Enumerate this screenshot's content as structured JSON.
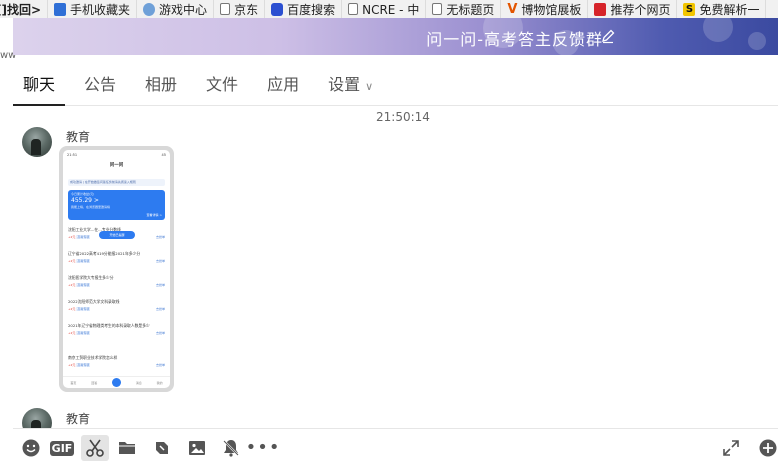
{
  "bookmarks": [
    {
      "label": "[]找回>",
      "icon": "none"
    },
    {
      "label": "手机收藏夹",
      "icon": "mobile-icon"
    },
    {
      "label": "游戏中心",
      "icon": "game-icon"
    },
    {
      "label": "京东",
      "icon": "page-icon"
    },
    {
      "label": "百度搜索",
      "icon": "paw-icon"
    },
    {
      "label": "NCRE - 中",
      "icon": "page-icon"
    },
    {
      "label": "无标题页",
      "icon": "page-icon"
    },
    {
      "label": "博物馆展板",
      "icon": "v-icon"
    },
    {
      "label": "推荐个网页",
      "icon": "red-icon"
    },
    {
      "label": "免费解析一",
      "icon": "s-icon"
    }
  ],
  "left_strip_text": "ww",
  "header": {
    "group_title": "问一问-高考答主反馈群",
    "edit_icon": "pencil-icon"
  },
  "tabs": [
    {
      "label": "聊天",
      "active": true
    },
    {
      "label": "公告"
    },
    {
      "label": "相册"
    },
    {
      "label": "文件"
    },
    {
      "label": "应用"
    },
    {
      "label": "设置",
      "dropdown": true
    }
  ],
  "chat": {
    "timestamp": "21:50:14",
    "messages": [
      {
        "sender": "教育",
        "type": "image"
      },
      {
        "sender": "教育",
        "type": "text"
      }
    ]
  },
  "phone_screenshot": {
    "status_time": "21:51",
    "status_right": "45",
    "title": "问一问",
    "notice": "成功邀请 | 在开始做签问答任务前请先阅读入规则",
    "card_label": "今日累计收益(元)",
    "card_amount": "455.29 >",
    "card_sub": "我能上榜，在浏览器里邀请榜",
    "card_right": "查看详情 >",
    "float_label": "开始已提醒",
    "questions": [
      {
        "text": "沈阳工业大学...在...专业分数线",
        "pay": "+2元",
        "tag": "高考专项",
        "answer": "去抢单"
      },
      {
        "text": "辽宁省2022高考419分能报2021年多少分",
        "pay": "+2元",
        "tag": "高考专项",
        "answer": "去抢单"
      },
      {
        "text": "沈阳医学院大专报生多少分",
        "pay": "+2元",
        "tag": "高考专项",
        "answer": "去抢单"
      },
      {
        "text": "2022沈阳师范大学文科录取线",
        "pay": "+2元",
        "tag": "高考专项",
        "answer": "去抢单"
      },
      {
        "text": "2021年辽宁省物理类考生的本科录取人数是多少",
        "pay": "+2元",
        "tag": "高考专项",
        "answer": "去抢单"
      },
      {
        "text": "南京工贸职业技术学院怎么样",
        "pay": "+2元",
        "tag": "高考专项",
        "answer": "去抢单"
      }
    ],
    "nav": [
      "首页",
      "回答",
      "",
      "消息",
      "我的"
    ]
  },
  "toolbar": {
    "items": [
      "emoji-icon",
      "gif-icon",
      "scissors-icon",
      "folder-icon",
      "clip-icon",
      "image-icon",
      "mute-bell-icon",
      "more-icon"
    ],
    "gif_label": "GIF",
    "more_label": "•••",
    "right_items": [
      "expand-icon",
      "add-icon"
    ]
  }
}
